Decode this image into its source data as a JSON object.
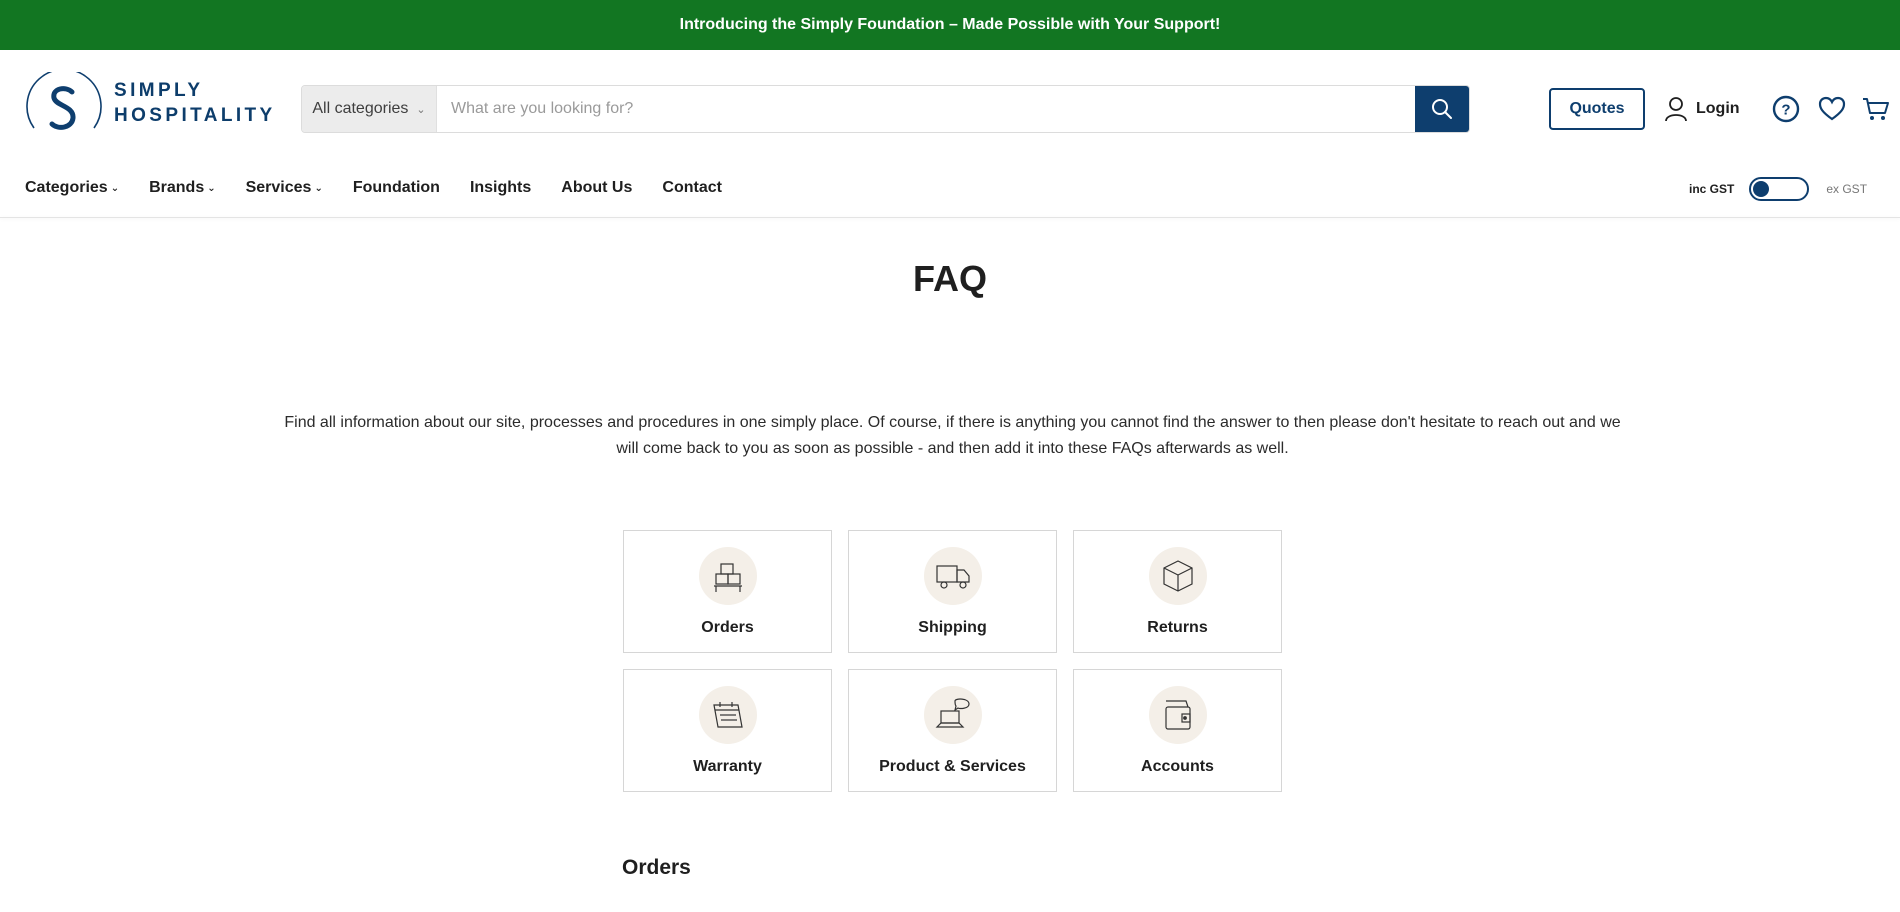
{
  "announcement": {
    "text": "Introducing the Simply Foundation – Made Possible with Your Support!"
  },
  "logo": {
    "line1": "SIMPLY",
    "line2": "HOSPITALITY"
  },
  "search": {
    "category": "All categories",
    "placeholder": "What are you looking for?"
  },
  "header": {
    "quotes_label": "Quotes",
    "login_label": "Login"
  },
  "nav": {
    "items": [
      {
        "label": "Categories",
        "dropdown": true
      },
      {
        "label": "Brands",
        "dropdown": true
      },
      {
        "label": "Services",
        "dropdown": true
      },
      {
        "label": "Foundation",
        "dropdown": false
      },
      {
        "label": "Insights",
        "dropdown": false
      },
      {
        "label": "About Us",
        "dropdown": false
      },
      {
        "label": "Contact",
        "dropdown": false
      }
    ]
  },
  "gst": {
    "inc_label": "inc GST",
    "ex_label": "ex GST"
  },
  "page": {
    "title": "FAQ",
    "intro": "Find all information about our site, processes and procedures in one simply place. Of course, if there is anything you cannot find the answer to then please don't hesitate to reach out and we will come back to you as soon as possible - and then add it into these FAQs afterwards as well.",
    "section_title": "Orders"
  },
  "categories": [
    {
      "label": "Orders",
      "icon": "orders-boxes-icon"
    },
    {
      "label": "Shipping",
      "icon": "shipping-truck-icon"
    },
    {
      "label": "Returns",
      "icon": "returns-box-icon"
    },
    {
      "label": "Warranty",
      "icon": "warranty-calendar-icon"
    },
    {
      "label": "Product & Services",
      "icon": "laptop-chat-icon"
    },
    {
      "label": "Accounts",
      "icon": "accounts-wallet-icon"
    }
  ],
  "colors": {
    "announcement_bg": "#127622",
    "brand_navy": "#0e3e6e",
    "icon_circle": "#f4efe8"
  }
}
